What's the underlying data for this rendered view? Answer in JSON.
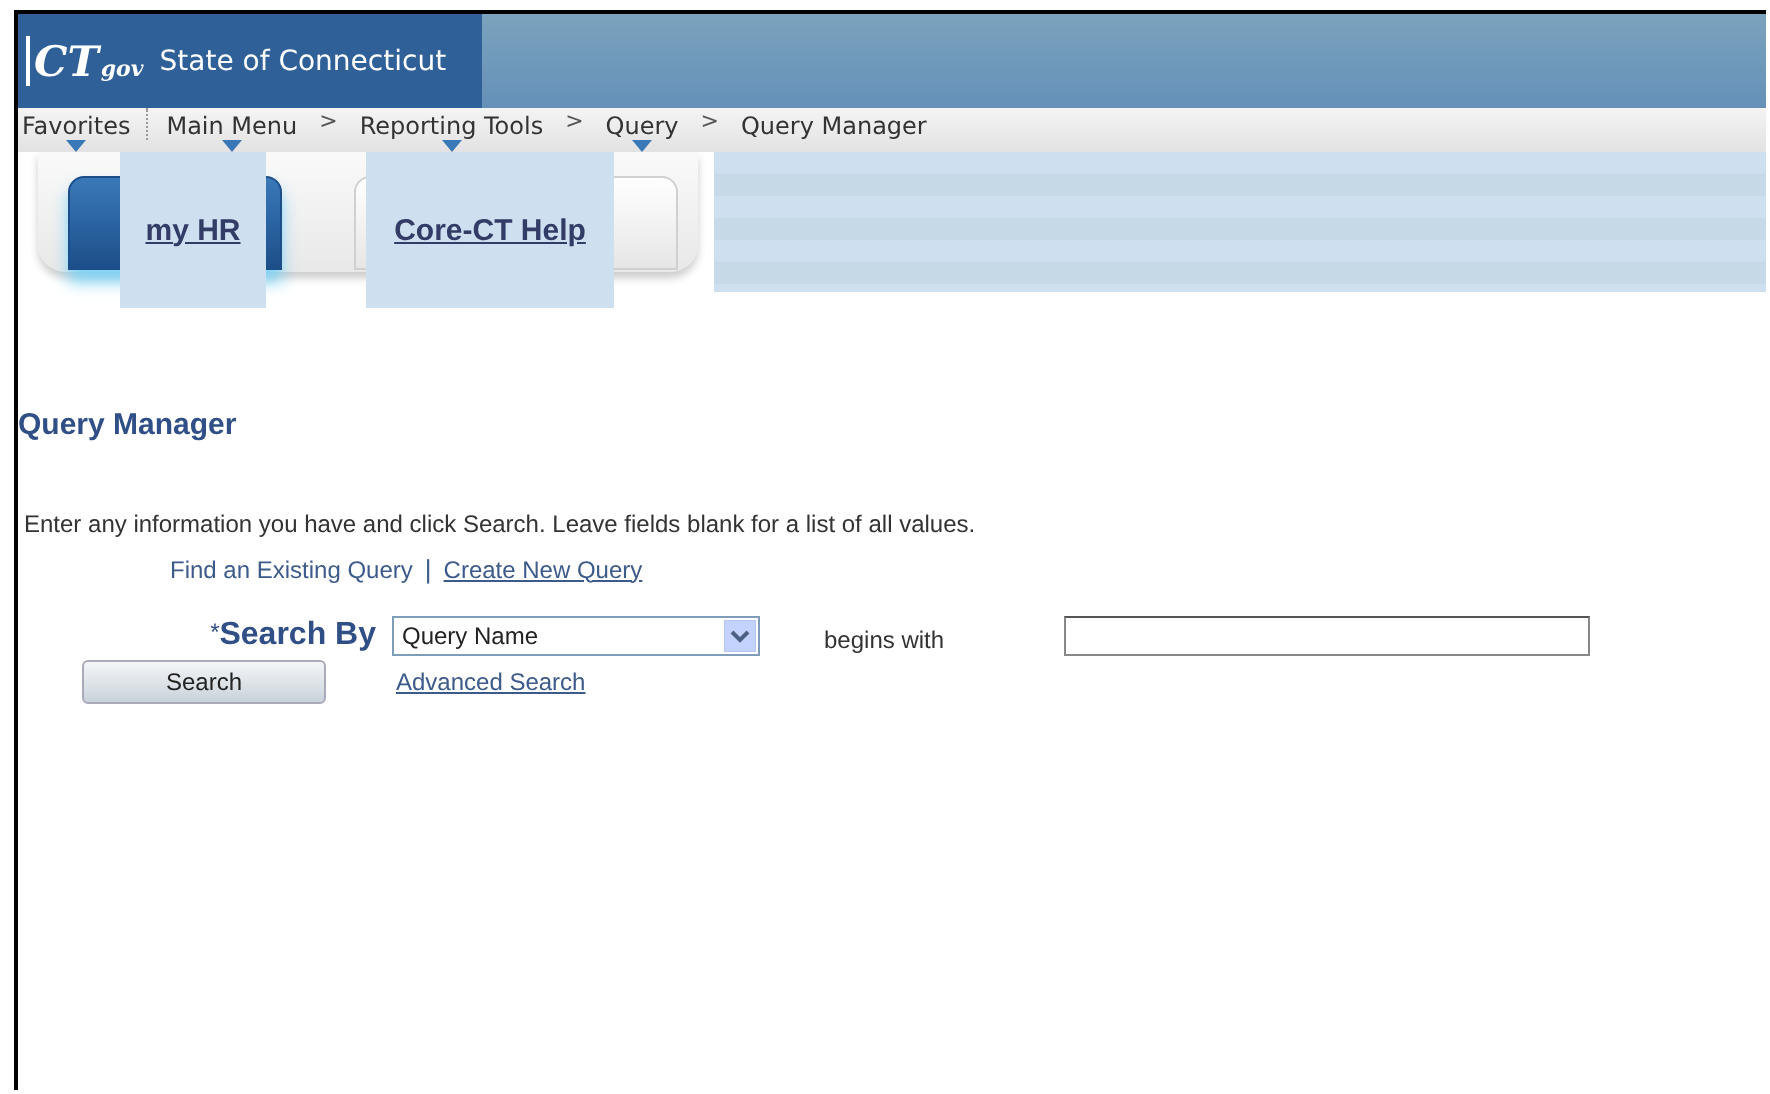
{
  "header": {
    "logo": "CT",
    "logo_suffix": "gov",
    "title": "State of Connecticut"
  },
  "breadcrumb": [
    {
      "label": "Favorites",
      "has_menu": true
    },
    {
      "label": "Main Menu",
      "has_menu": true
    },
    {
      "label": "Reporting Tools",
      "has_menu": true,
      "separator": ">"
    },
    {
      "label": "Query",
      "has_menu": true,
      "separator": ">"
    },
    {
      "label": "Query Manager",
      "has_menu": false,
      "separator": ">"
    }
  ],
  "tabs": [
    {
      "label": "my HR",
      "selected": true
    },
    {
      "label": "Core-CT Help",
      "selected": false
    }
  ],
  "page_title": "Query Manager",
  "instructions": "Enter any information you have and click Search. Leave fields blank for a list of all values.",
  "modes": [
    {
      "label": "Find an Existing Query",
      "selected": true
    },
    {
      "label": "Create New Query",
      "selected": false
    }
  ],
  "mode_separator": "|",
  "search": {
    "required_mark": "*",
    "label": "Search By",
    "select_value": "Query Name",
    "operator": "begins with",
    "button": "Search",
    "advanced_link": "Advanced Search"
  }
}
